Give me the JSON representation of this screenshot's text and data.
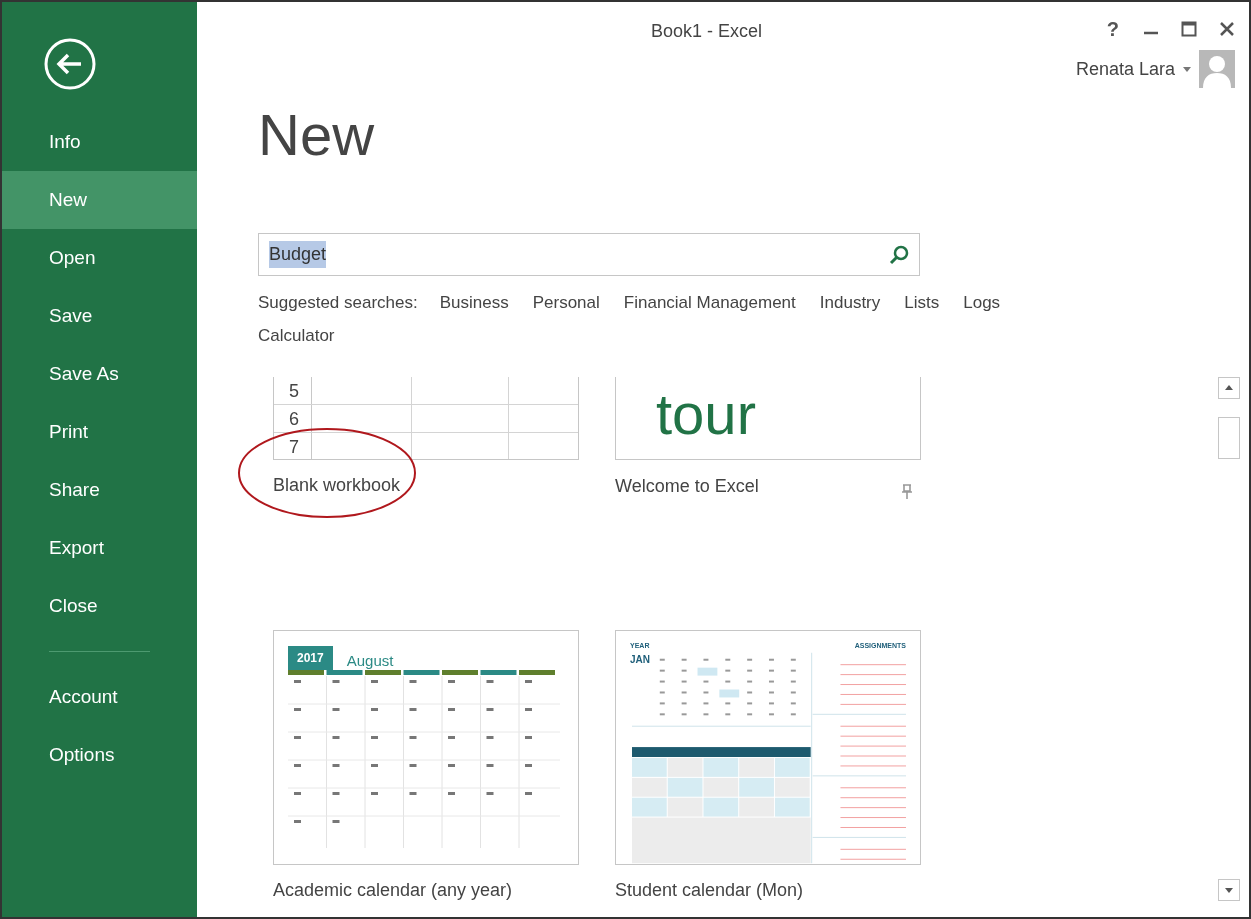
{
  "window": {
    "title": "Book1 - Excel",
    "help": "?",
    "user": "Renata Lara"
  },
  "sidebar": {
    "items": [
      {
        "label": "Info",
        "selected": false
      },
      {
        "label": "New",
        "selected": true
      },
      {
        "label": "Open",
        "selected": false
      },
      {
        "label": "Save",
        "selected": false
      },
      {
        "label": "Save As",
        "selected": false
      },
      {
        "label": "Print",
        "selected": false
      },
      {
        "label": "Share",
        "selected": false
      },
      {
        "label": "Export",
        "selected": false
      },
      {
        "label": "Close",
        "selected": false
      }
    ],
    "footer_items": [
      {
        "label": "Account",
        "selected": false
      },
      {
        "label": "Options",
        "selected": false
      }
    ]
  },
  "heading": "New",
  "search": {
    "value": "Budget",
    "highlighted": true
  },
  "suggested": {
    "label": "Suggested searches:",
    "items": [
      "Business",
      "Personal",
      "Financial Management",
      "Industry",
      "Lists",
      "Logs",
      "Calculator"
    ]
  },
  "templates": [
    {
      "kind": "blank",
      "label": "Blank workbook",
      "rows": [
        "5",
        "6",
        "7"
      ],
      "circled": true
    },
    {
      "kind": "tour",
      "label": "Welcome to Excel",
      "word": "tour",
      "pin": true
    },
    {
      "kind": "calendar",
      "label": "Academic calendar (any year)",
      "year": "2017",
      "month": "August"
    },
    {
      "kind": "student",
      "label": "Student calendar (Mon)",
      "year_label": "YEAR",
      "month": "JAN",
      "side_title": "ASSIGNMENTS"
    }
  ]
}
